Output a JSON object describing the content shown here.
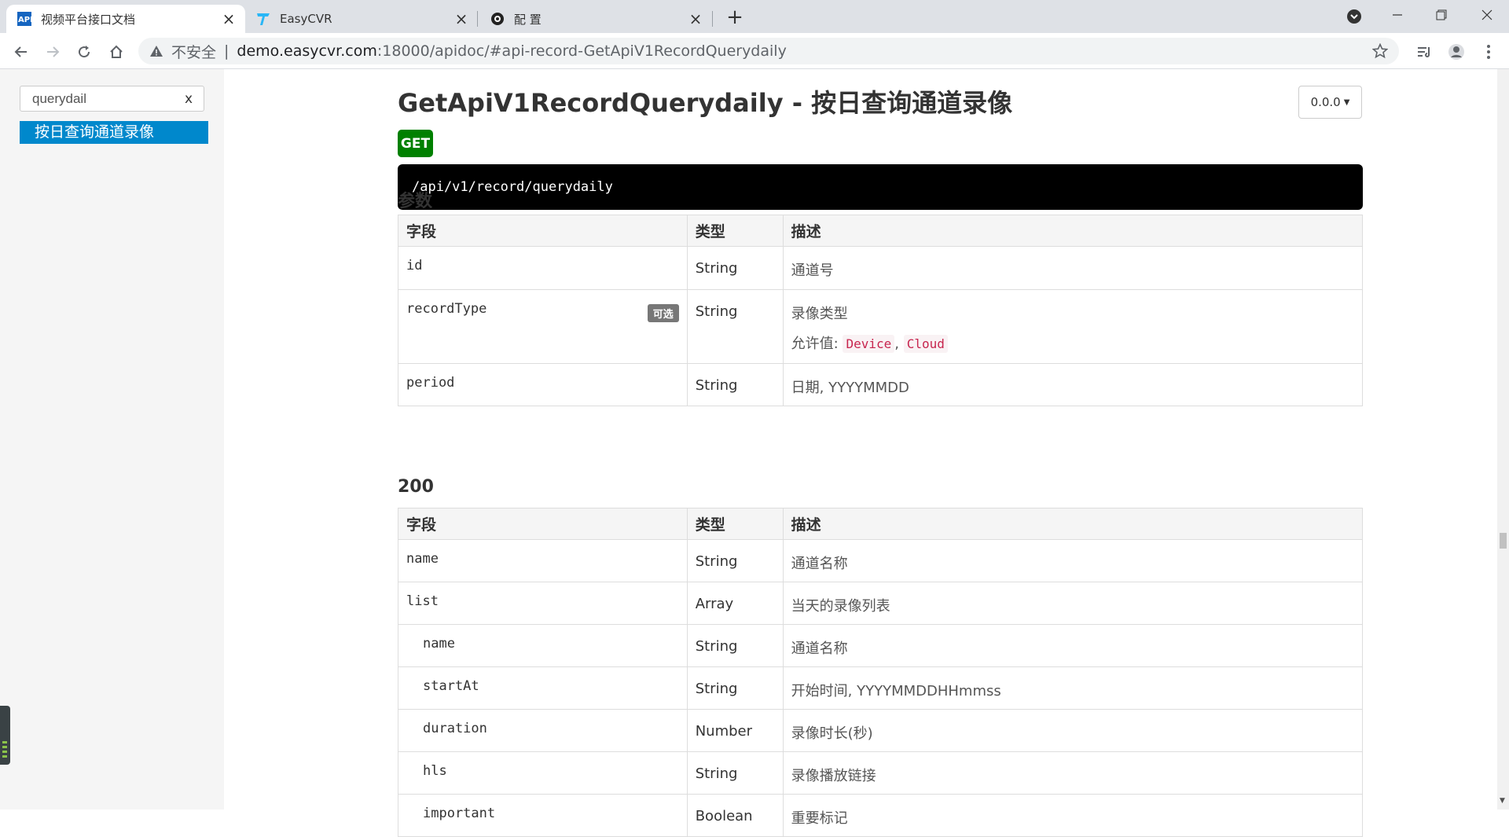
{
  "browser": {
    "tabs": [
      {
        "title": "视频平台接口文档",
        "favicon": "API",
        "active": true
      },
      {
        "title": "EasyCVR",
        "favicon": "easycvr-logo",
        "active": false
      },
      {
        "title": "配 置",
        "favicon": "camera-icon",
        "active": false
      }
    ],
    "address": {
      "warning": "不安全",
      "host": "demo.easycvr.com",
      "path": ":18000/apidoc/#api-record-GetApiV1RecordQuerydaily"
    }
  },
  "sidebar": {
    "search_value": "querydail",
    "clear_label": "x",
    "items": [
      {
        "label": "按日查询通道录像"
      }
    ]
  },
  "main": {
    "title": "GetApiV1RecordQuerydaily - 按日查询通道录像",
    "version": "0.0.0",
    "method": "GET",
    "endpoint": "/api/v1/record/querydaily",
    "params_heading": "参数",
    "table_headers": {
      "field": "字段",
      "type": "类型",
      "desc": "描述"
    },
    "params": [
      {
        "field": "id",
        "type": "String",
        "desc": "通道号"
      },
      {
        "field": "recordType",
        "optional": "可选",
        "type": "String",
        "desc": "录像类型",
        "allowed_label": "允许值:",
        "allowed": [
          "Device",
          "Cloud"
        ]
      },
      {
        "field": "period",
        "type": "String",
        "desc": "日期, YYYYMMDD"
      }
    ],
    "response_heading": "200",
    "response": [
      {
        "field": "name",
        "type": "String",
        "desc": "通道名称"
      },
      {
        "field": "list",
        "type": "Array",
        "desc": "当天的录像列表"
      },
      {
        "field": "name",
        "type": "String",
        "desc": "通道名称"
      },
      {
        "field": "startAt",
        "type": "String",
        "desc": "开始时间, YYYYMMDDHHmmss"
      },
      {
        "field": "duration",
        "type": "Number",
        "desc": "录像时长(秒)"
      },
      {
        "field": "hls",
        "type": "String",
        "desc": "录像播放链接"
      },
      {
        "field": "important",
        "type": "Boolean",
        "desc": "重要标记"
      }
    ]
  }
}
